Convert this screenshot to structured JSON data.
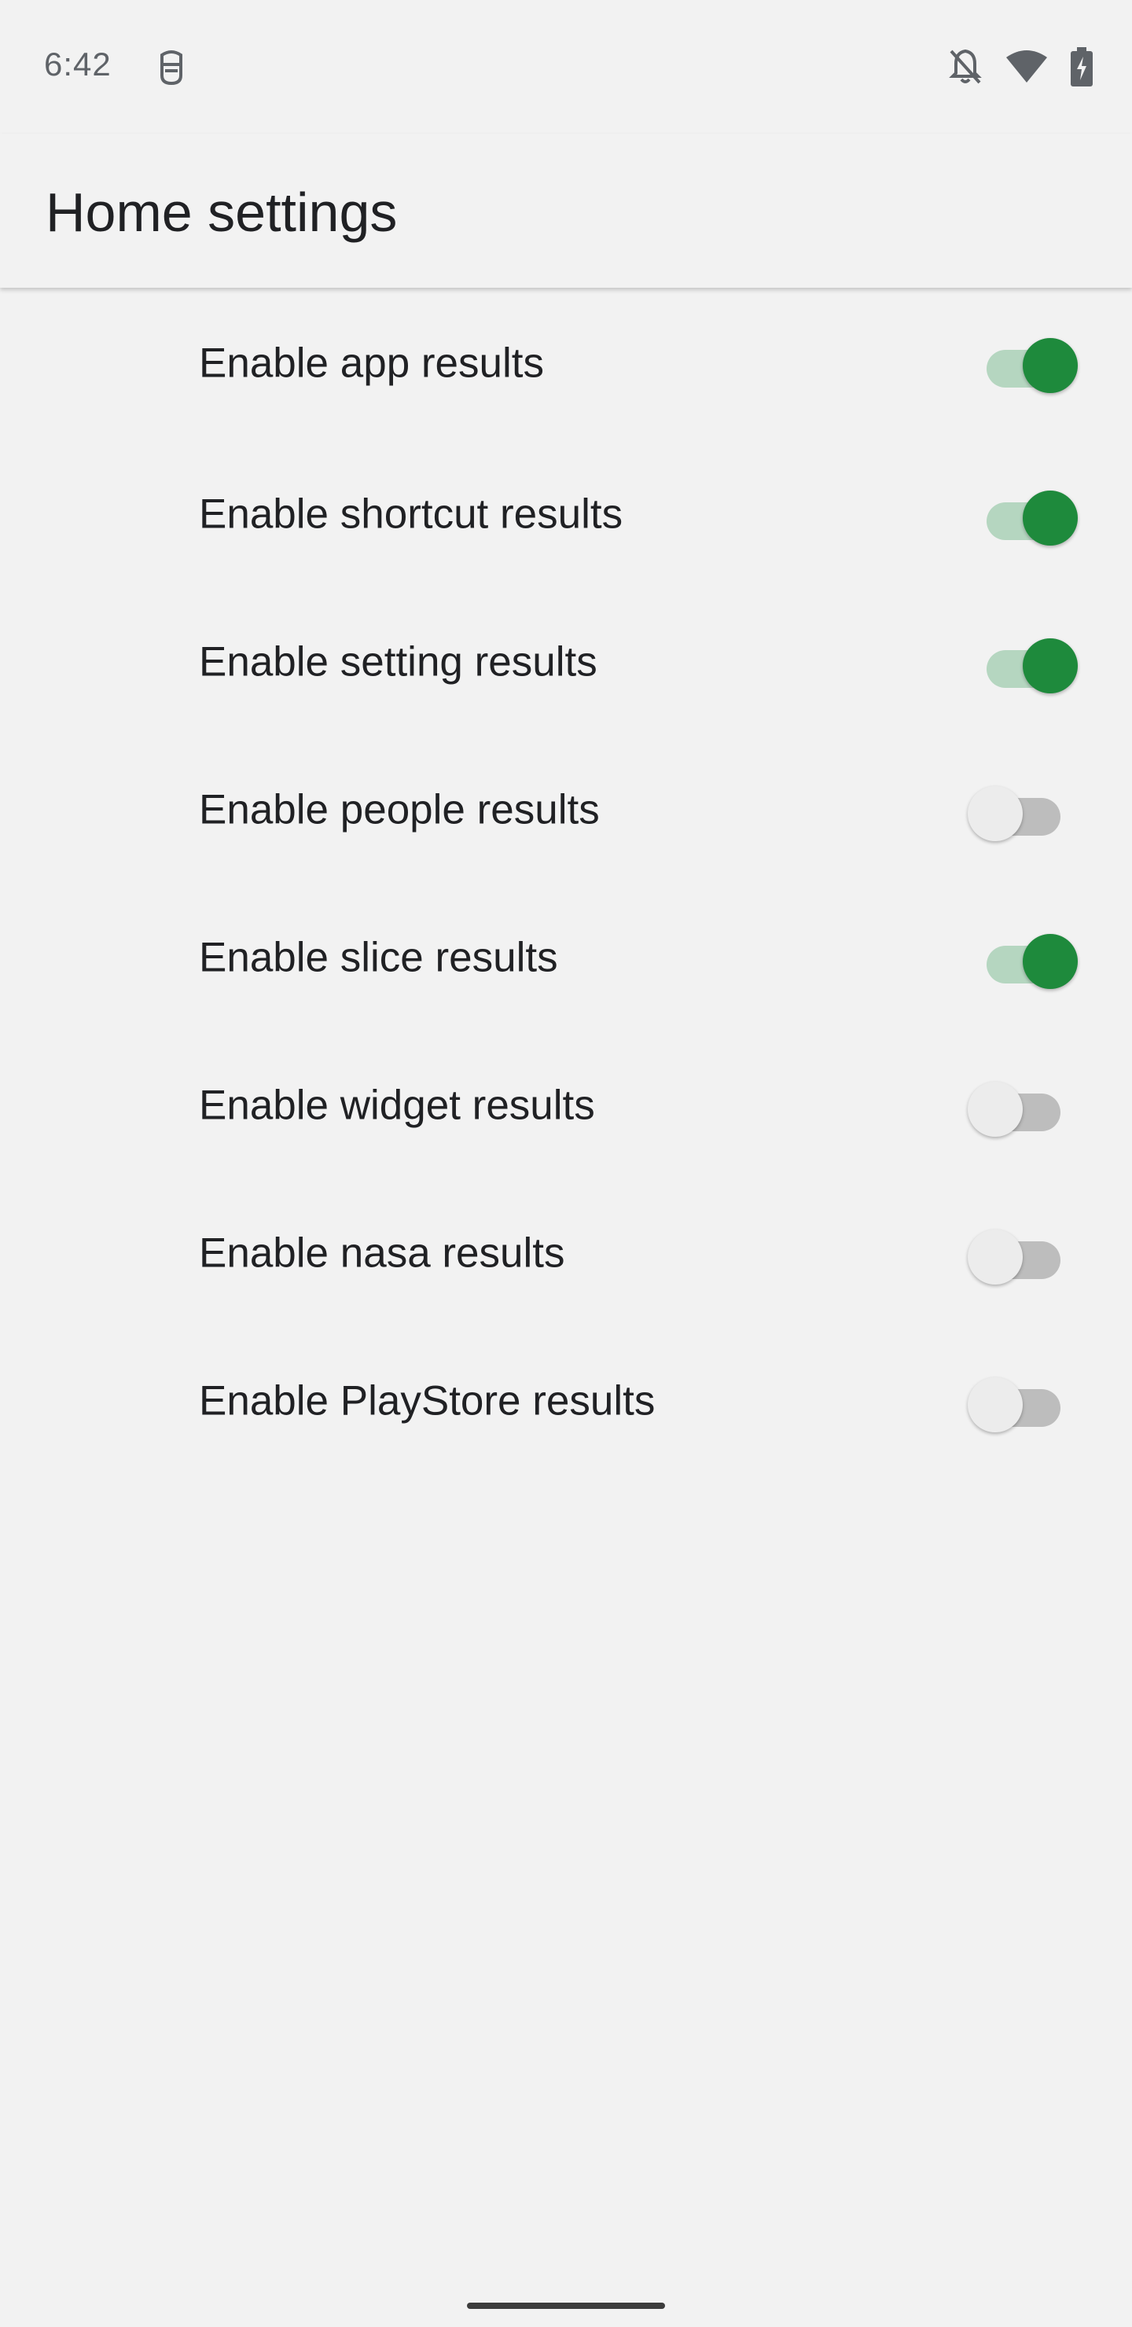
{
  "status_bar": {
    "time": "6:42",
    "icons": [
      "app-notification-icon",
      "bell-off-icon",
      "wifi-icon",
      "battery-charging-icon"
    ]
  },
  "app_bar": {
    "title": "Home settings"
  },
  "colors": {
    "background": "#f2f2f2",
    "switch_on_thumb": "#1e8a3c",
    "switch_on_track": "#b5d6c0",
    "switch_off_thumb": "#ececec",
    "switch_off_track": "#bdbdbd"
  },
  "settings": [
    {
      "label": "Enable app results",
      "enabled": true
    },
    {
      "label": "Enable shortcut results",
      "enabled": true
    },
    {
      "label": "Enable setting results",
      "enabled": true
    },
    {
      "label": "Enable people results",
      "enabled": false
    },
    {
      "label": "Enable slice results",
      "enabled": true
    },
    {
      "label": "Enable widget results",
      "enabled": false
    },
    {
      "label": "Enable nasa results",
      "enabled": false
    },
    {
      "label": "Enable PlayStore results",
      "enabled": false
    }
  ]
}
